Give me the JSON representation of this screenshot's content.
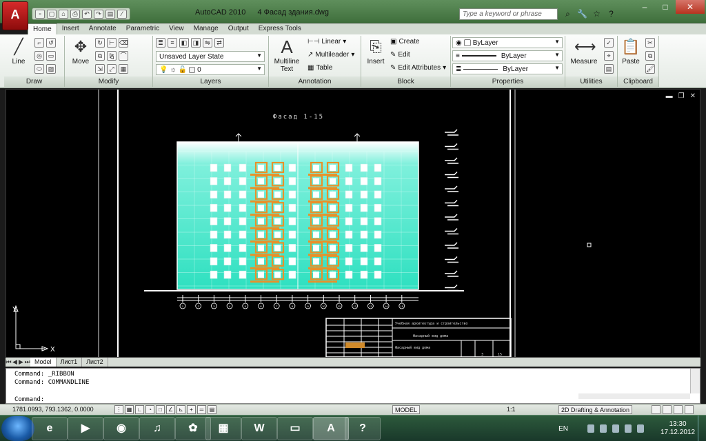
{
  "window": {
    "app_name": "AutoCAD 2010",
    "document": "4 Фасад здания.dwg",
    "app_button_letter": "A",
    "search_placeholder": "Type a keyword or phrase",
    "controls": [
      "–",
      "□",
      "✕"
    ]
  },
  "quick_access": [
    "▫",
    "▢",
    "⌂",
    "⎙",
    "↶",
    "↷",
    "▤",
    "⁄"
  ],
  "tabs": [
    "Home",
    "Insert",
    "Annotate",
    "Parametric",
    "View",
    "Manage",
    "Output",
    "Express Tools"
  ],
  "active_tab": "Home",
  "ribbon": {
    "draw": {
      "title": "Draw",
      "line_label": "Line"
    },
    "modify": {
      "title": "Modify",
      "move_label": "Move"
    },
    "layers": {
      "title": "Layers",
      "layer_state": "Unsaved Layer State",
      "current_layer": "0"
    },
    "annotation": {
      "title": "Annotation",
      "multiline_label": "Multiline",
      "text_label": "Text",
      "linear": "Linear",
      "multileader": "Multileader",
      "table": "Table"
    },
    "block": {
      "title": "Block",
      "insert_label": "Insert",
      "create": "Create",
      "edit": "Edit",
      "edit_attributes": "Edit Attributes"
    },
    "properties": {
      "title": "Properties",
      "color": "ByLayer",
      "linetype": "ByLayer",
      "lineweight": "ByLayer"
    },
    "utilities": {
      "title": "Utilities",
      "measure_label": "Measure"
    },
    "clipboard": {
      "title": "Clipboard",
      "paste_label": "Paste"
    }
  },
  "drawing": {
    "facade_title": "Фасад 1-15",
    "axis_labels": [
      "1",
      "2",
      "3",
      "4",
      "5",
      "6",
      "7",
      "8",
      "9",
      "10",
      "11",
      "12",
      "13",
      "14",
      "15"
    ],
    "ucs_x": "X",
    "ucs_y": "Y",
    "stamp_texts": [
      "Учебная архитектура и строительство",
      "Фасадный вид дома",
      "Фасадный вид дома",
      "3",
      "15"
    ],
    "stamp_highlight_color": "#d08a2a"
  },
  "layout_tabs": [
    "Model",
    "Лист1",
    "Лист2"
  ],
  "command_history": [
    "Command:  _RIBBON",
    "Command:  COMMANDLINE"
  ],
  "command_prompt": "Command:",
  "status": {
    "coordinates": "1781.0993, 793.1362, 0.0000",
    "model": "MODEL",
    "annotation_scale": "1:1",
    "workspace": "2D Drafting & Annotation"
  },
  "taskbar": {
    "apps": [
      "e",
      "▶",
      "◉",
      "♫",
      "✿",
      "▦",
      "W",
      "▭",
      "A",
      "?"
    ],
    "language": "EN",
    "time": "13:30",
    "date": "17.12.2012"
  }
}
